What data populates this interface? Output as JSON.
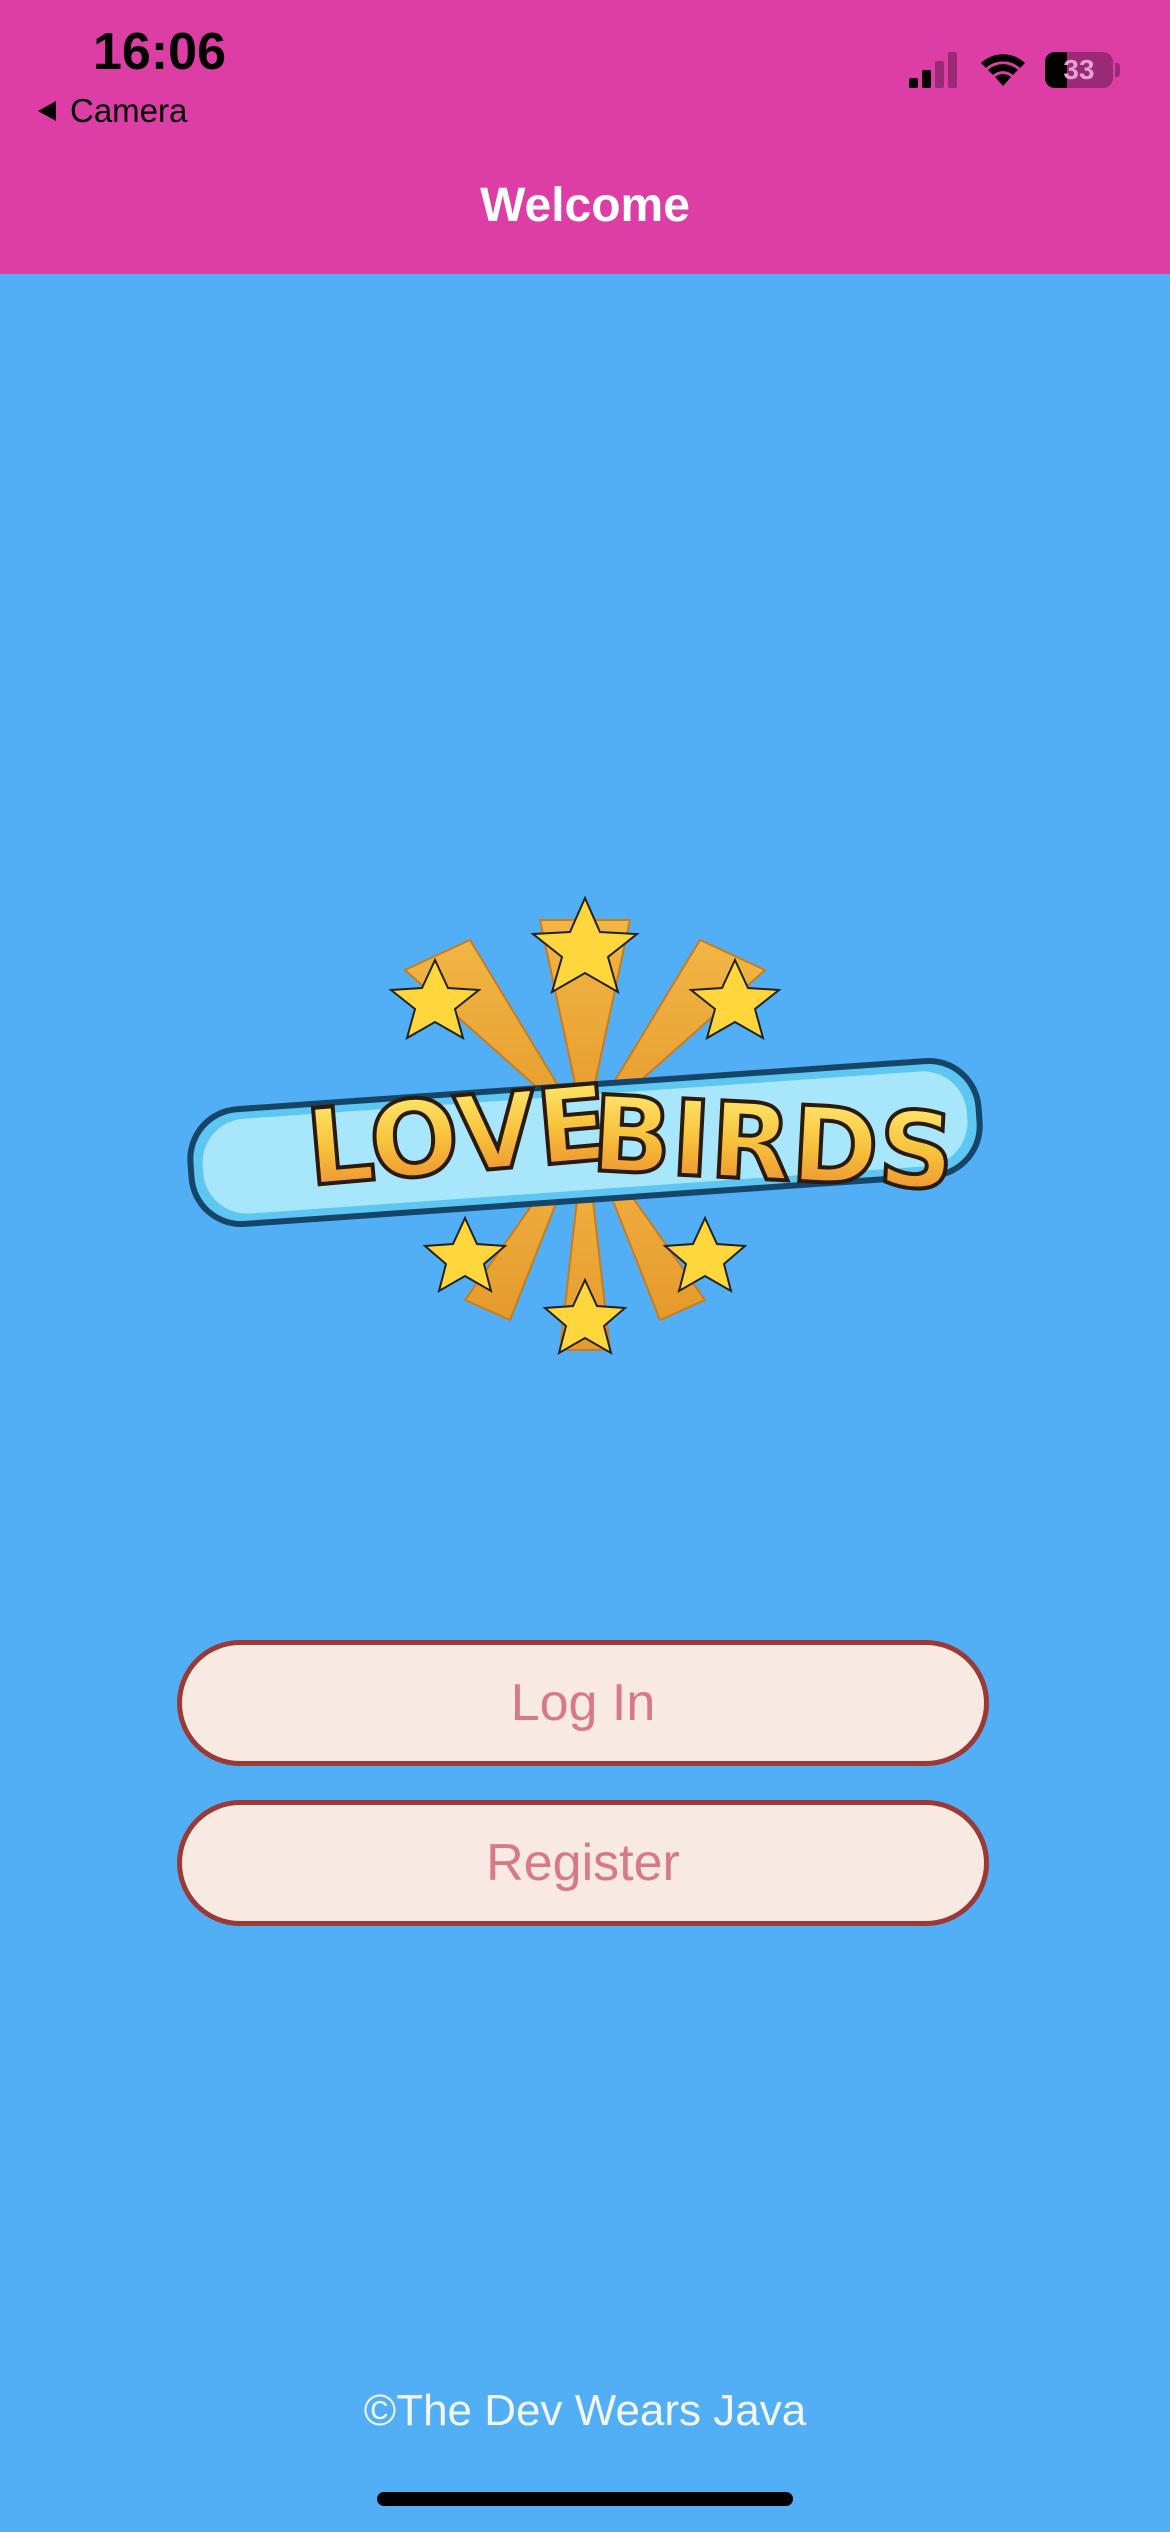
{
  "status_bar": {
    "time": "16:06",
    "back_app": "Camera",
    "battery_level": "33"
  },
  "nav": {
    "title": "Welcome"
  },
  "logo": {
    "text_left": "LOVE",
    "text_right": "BIRDS"
  },
  "buttons": {
    "login": "Log In",
    "register": "Register"
  },
  "footer": {
    "copyright": "©The Dev Wears Java"
  },
  "colors": {
    "header": "#dd3ea6",
    "background": "#52aff5",
    "button_fill": "#f8e9e3",
    "button_border": "#9a3a36",
    "button_text": "#d77a86"
  }
}
